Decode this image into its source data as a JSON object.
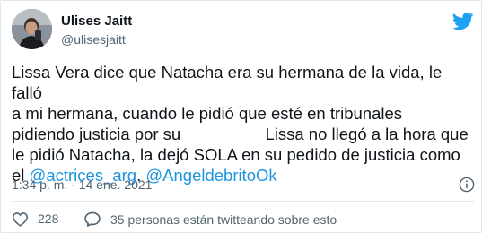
{
  "author": {
    "display_name": "Ulises Jaitt",
    "handle": "@ulisesjaitt"
  },
  "tweet": {
    "text_before": "Lissa Vera dice que Natacha era su hermana de la vida, le falló\na mi hermana, cuando le pidió que esté en tribunales\npidiendo justicia por su ",
    "text_after": " Lissa no llegó a la hora que\nle pidió Natacha, la dejó SOLA en su pedido de justicia como\nel ",
    "mention_1": "@actrices_arg",
    "separator": ". ",
    "mention_2": "@AngeldebritoOk"
  },
  "meta": {
    "timestamp": "1:34 p. m. · 14 ene. 2021"
  },
  "actions": {
    "like_count": "228",
    "conversation_text": "35 personas están twitteando sobre esto"
  },
  "colors": {
    "brand_blue": "#1da1f2",
    "mention_blue": "#1b95e0",
    "like_red": "#e0245e",
    "secondary_text": "#536471"
  },
  "icons": {
    "brand": "twitter-bird-icon",
    "info": "info-icon",
    "like": "heart-icon",
    "conversation": "speech-bubble-icon"
  }
}
